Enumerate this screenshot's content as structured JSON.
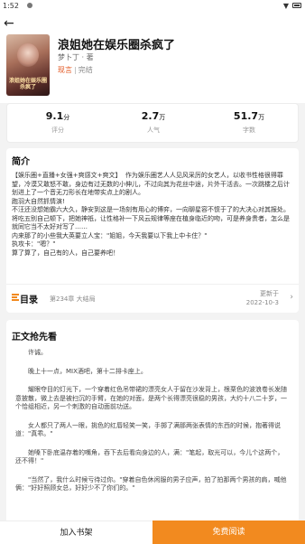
{
  "status": {
    "time": "1:52"
  },
  "book": {
    "title": "浪姐她在娱乐圈杀疯了",
    "author": "梦卜丁 · 著",
    "genre": "现言",
    "state": "完结",
    "cover_text": "浪姐她在娱乐圈杀疯了"
  },
  "stats": [
    {
      "value": "9.1",
      "unit": "分",
      "label": "评分"
    },
    {
      "value": "2.7",
      "unit": "万",
      "label": "人气"
    },
    {
      "value": "51.7",
      "unit": "万",
      "label": "字数"
    }
  ],
  "intro": {
    "heading": "简介",
    "text": "【娱乐圈+直播+女强+爽感文+爽文】  作为娱乐圈艺人人见风采厉的女艺人，以收书性格很得罪望，冷漠又敢怒不敢，身边有过无数的小伸儿，不过向其为花丝中途，片外干活去。一次跳楼之后计划进上了一个音无刀形长在地带实点上的剧人。\n跑羽大自然抓情演!\n不汪还没想她霸六大久，静安到这是一场刻有用心的博弈，一向聊星容不惯于了的大决心对其报处。将吃五别自己顿下，把她神祇，让性格补一下风云规律等座在植身临近的吻，可是养身贵者，怎么是就同它当不太好对写了……\n内来那了的小些我大英要立人宝：\"姐姐，今天我要以下我上中卡住？\"\n执攻卡：\"嗯？\"\n算了算了，自己有的人，自己要养吧！"
  },
  "toc": {
    "label": "目录",
    "latest": "第234章 大结局",
    "updated_line1": "更新于",
    "updated_line2": "2022-10-3"
  },
  "preview": {
    "heading": "正文抢先看",
    "paragraphs": [
      "许诚。",
      "晚上十一点，MIX酒吧，第十二排卡座上。",
      "耀眼夺目的灯光下，一个穿着红色吊带裙的漂亮女人于留在沙发背上，根栗色的波浪卷长发随意披散，微上去是被扫沉的手臂，在她的对面，是两个长得漂亮很稳的男孩，大约十八二十岁，一个恰组相近，另一个刺激的自动面前功送。",
      "女人都只了两人一眼，挑色的红唇轻笑一笑，手掷了满那两张表情的东西的时候，抱著得说道：\"真乖。\"",
      "她嗓下卧底温存着的嘴角，吞下去后看向身边的人，满：\"笔起，取光可以，今儿个这两个，还不得！\"",
      "\"当然了，我什么时候亏待过你。\"穿着自色休闲服的男子应声，拍了拍那两个男孩的肩，喊他俩：\"好好照顾女总，好好少不了你们的。\""
    ]
  },
  "bottom": {
    "shelf_label": "加入书架",
    "read_label": "免费阅读"
  },
  "colors": {
    "accent": "#f28a1f",
    "genre": "#e2541e"
  }
}
